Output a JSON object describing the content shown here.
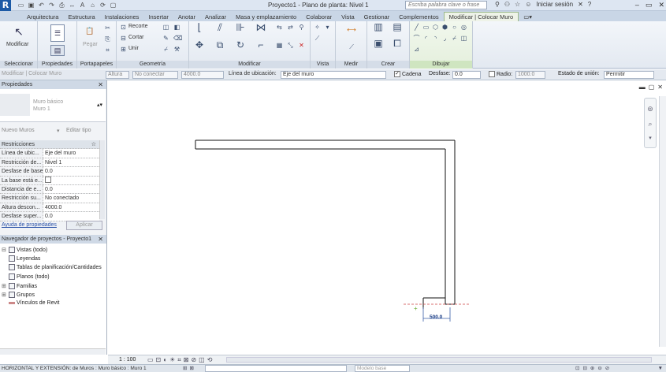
{
  "titlebar": {
    "logo": "R",
    "title": "Proyecto1 - Plano de planta: Nivel 1",
    "search_placeholder": "Escriba palabra clave o frase",
    "signin": "Iniciar sesión"
  },
  "tabs": [
    {
      "label": "Arquitectura"
    },
    {
      "label": "Estructura"
    },
    {
      "label": "Instalaciones"
    },
    {
      "label": "Insertar"
    },
    {
      "label": "Anotar"
    },
    {
      "label": "Analizar"
    },
    {
      "label": "Masa y emplazamiento"
    },
    {
      "label": "Colaborar"
    },
    {
      "label": "Vista"
    },
    {
      "label": "Gestionar"
    },
    {
      "label": "Complementos"
    },
    {
      "label": "Modificar | Colocar Muro"
    }
  ],
  "ribbon": {
    "modify_label": "Modificar",
    "select_label": "Seleccionar",
    "properties_label": "Propiedades",
    "clipboard_label": "Portapapeles",
    "paste_label": "Pegar",
    "geometry_label": "Geometría",
    "cut_label": "Cortar",
    "join_label": "Unir",
    "cope_label": "Recorte",
    "modify_panel_label": "Modificar",
    "view_label": "Vista",
    "measure_label": "Medir",
    "create_label": "Crear",
    "draw_label": "Dibujar"
  },
  "options_bar": {
    "context": "Modificar | Colocar Muro",
    "height_mode": "Altura",
    "unconnected": "No conectar",
    "height_value": "4000.0",
    "location_line_label": "Línea de ubicación:",
    "location_line_value": "Eje del muro",
    "chain_label": "Cadena",
    "offset_label": "Desfase:",
    "offset_value": "0.0",
    "radius_label": "Radio:",
    "radius_value": "1000.0",
    "join_status_label": "Estado de unión:",
    "join_status_value": "Permitir"
  },
  "properties": {
    "header": "Propiedades",
    "type_family": "Muro básico",
    "type_name": "Muro 1",
    "filter": "Nuevo Muros",
    "edit_type": "Editar tipo",
    "rows": [
      {
        "k": "Restricciones",
        "v": ""
      },
      {
        "k": "Línea de ubic...",
        "v": "Eje del muro"
      },
      {
        "k": "Restricción de...",
        "v": "Nivel 1"
      },
      {
        "k": "Desfase de base",
        "v": "0.0"
      },
      {
        "k": "La base está e...",
        "v": ""
      },
      {
        "k": "Distancia de e...",
        "v": "0.0"
      },
      {
        "k": "Restricción su...",
        "v": "No conectado"
      },
      {
        "k": "Altura descon...",
        "v": "4000.0"
      },
      {
        "k": "Desfase super...",
        "v": "0.0"
      }
    ],
    "help": "Ayuda de propiedades",
    "apply": "Aplicar"
  },
  "browser": {
    "header": "Navegador de proyectos - Proyecto1",
    "items": [
      {
        "label": "Vistas (todo)",
        "sign": "⊟"
      },
      {
        "label": "Leyendas",
        "sign": ""
      },
      {
        "label": "Tablas de planificación/Cantidades",
        "sign": ""
      },
      {
        "label": "Planos (todo)",
        "sign": ""
      },
      {
        "label": "Familias",
        "sign": "⊞"
      },
      {
        "label": "Grupos",
        "sign": "⊞"
      },
      {
        "label": "Vínculos de Revit",
        "sign": ""
      }
    ]
  },
  "canvas": {
    "dimension": "500.0"
  },
  "viewbar": {
    "scale": "1 : 100"
  },
  "statusbar": {
    "text": "HORIZONTAL Y EXTENSIÓN: de Muros : Muro básico : Muro 1",
    "model": "Modelo base"
  }
}
